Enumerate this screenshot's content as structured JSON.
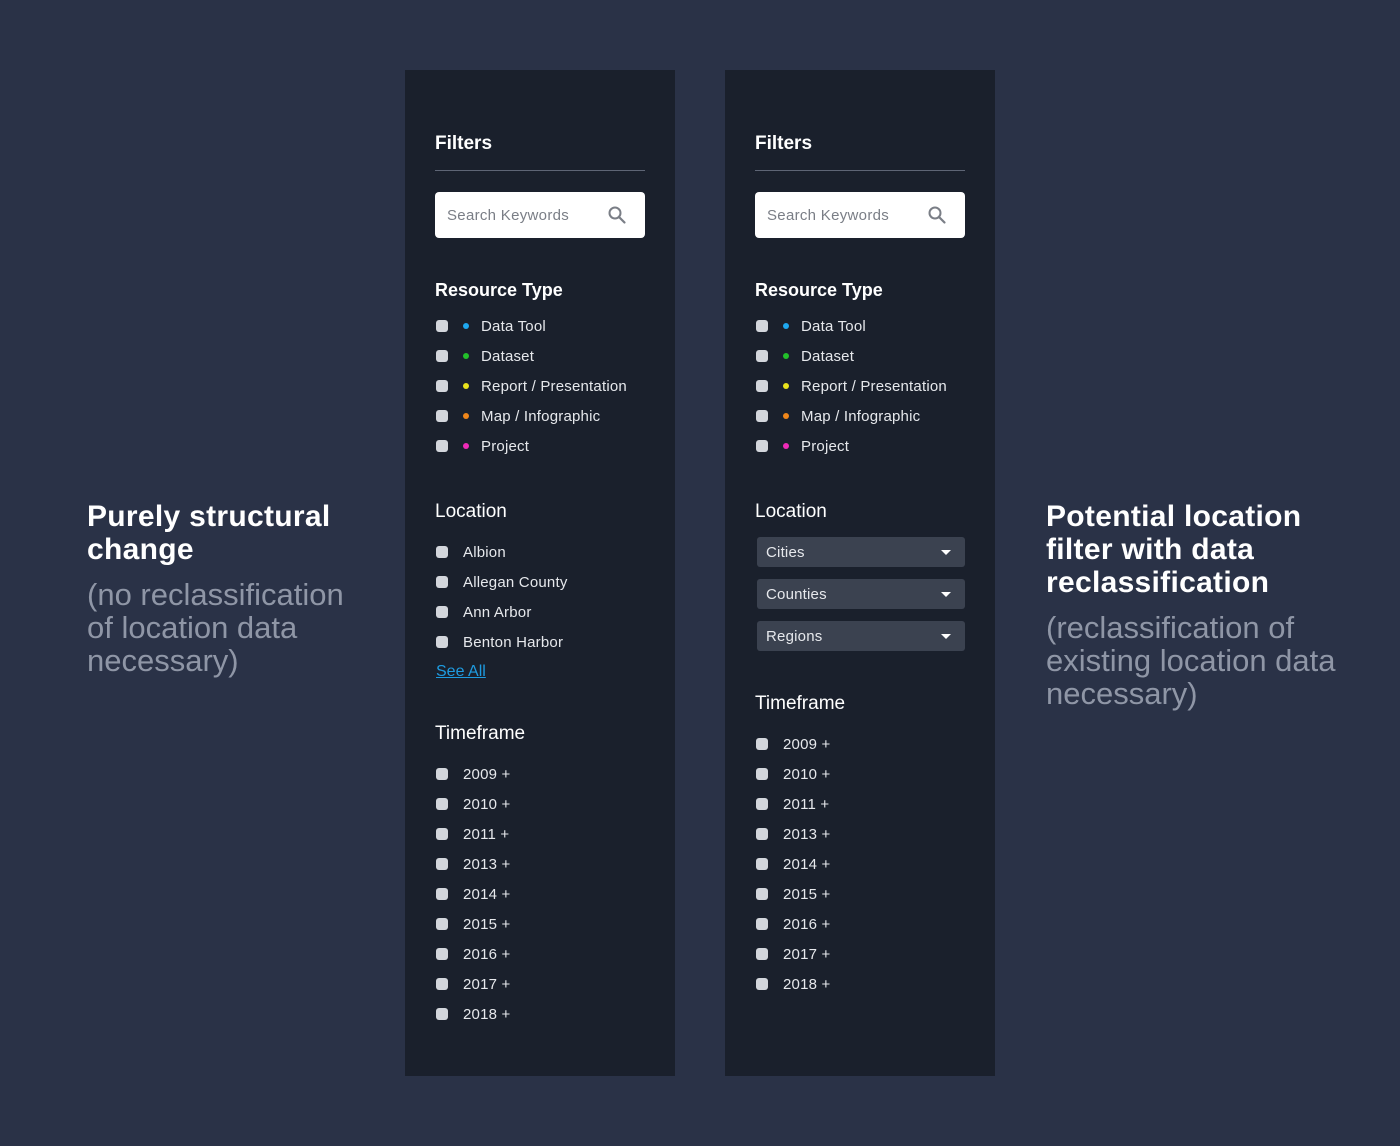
{
  "captions": {
    "left": {
      "heading": "Purely structural change",
      "sub": "(no reclassification of location data necessary)"
    },
    "right": {
      "heading": "Potential location filter with data reclassification",
      "sub": "(reclassification of existing location data necessary)"
    }
  },
  "colors": {
    "background": "#2a3247",
    "panel": "#1a202c",
    "link": "#1e9be0",
    "data_tool": "#1ea8f0",
    "dataset": "#22c02a",
    "report": "#e8e21c",
    "map": "#f0861a",
    "project": "#f02ab8"
  },
  "left_panel": {
    "title": "Filters",
    "search_placeholder": "Search Keywords",
    "resource_type": {
      "title": "Resource Type",
      "items": [
        "Data Tool",
        "Dataset",
        "Report / Presentation",
        "Map / Infographic",
        "Project"
      ]
    },
    "location": {
      "title": "Location",
      "items": [
        "Albion",
        "Allegan County",
        "Ann Arbor",
        "Benton Harbor"
      ],
      "see_all": "See All"
    },
    "timeframe": {
      "title": "Timeframe",
      "items": [
        "2009 +",
        "2010 +",
        "2011 +",
        "2013 +",
        "2014 +",
        "2015 +",
        "2016 +",
        "2017 +",
        "2018 +"
      ]
    }
  },
  "right_panel": {
    "title": "Filters",
    "search_placeholder": "Search Keywords",
    "resource_type": {
      "title": "Resource Type",
      "items": [
        "Data Tool",
        "Dataset",
        "Report / Presentation",
        "Map / Infographic",
        "Project"
      ]
    },
    "location": {
      "title": "Location",
      "selects": [
        "Cities",
        "Counties",
        "Regions"
      ]
    },
    "timeframe": {
      "title": "Timeframe",
      "items": [
        "2009 +",
        "2010 +",
        "2011 +",
        "2013 +",
        "2014 +",
        "2015 +",
        "2016 +",
        "2017 +",
        "2018 +"
      ]
    }
  }
}
